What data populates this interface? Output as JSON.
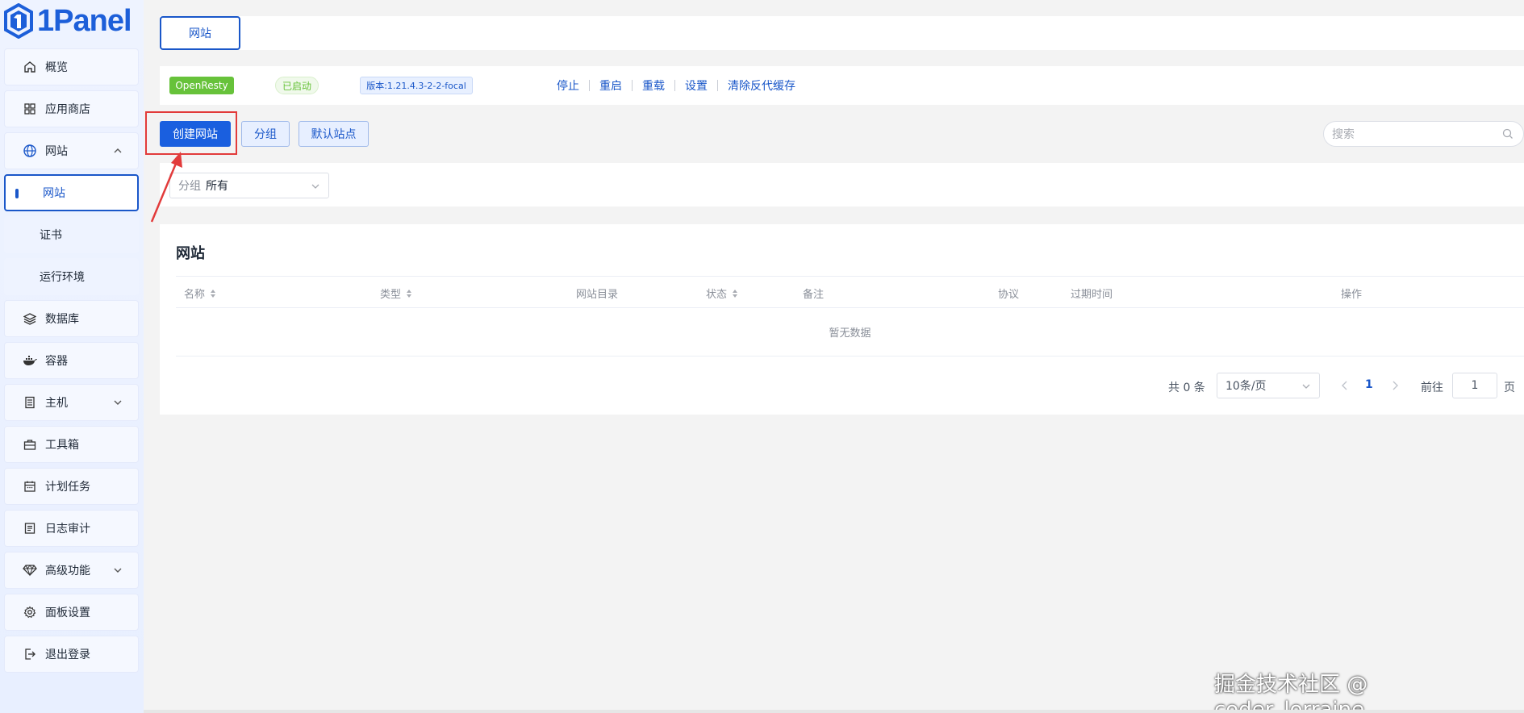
{
  "brand": {
    "logo_text": "1Panel",
    "accent": "#1a57c9"
  },
  "sidebar": {
    "items": [
      {
        "label": "概览",
        "icon": "home-icon"
      },
      {
        "label": "应用商店",
        "icon": "grid-icon"
      },
      {
        "label": "网站",
        "icon": "globe-icon",
        "expanded": true
      },
      {
        "label": "网站",
        "sub": true,
        "active": true
      },
      {
        "label": "证书",
        "sub": true
      },
      {
        "label": "运行环境",
        "sub": true
      },
      {
        "label": "数据库",
        "icon": "layers-icon"
      },
      {
        "label": "容器",
        "icon": "docker-icon"
      },
      {
        "label": "主机",
        "icon": "server-icon",
        "collapsible": true
      },
      {
        "label": "工具箱",
        "icon": "toolbox-icon"
      },
      {
        "label": "计划任务",
        "icon": "calendar-icon"
      },
      {
        "label": "日志审计",
        "icon": "log-icon"
      },
      {
        "label": "高级功能",
        "icon": "diamond-icon",
        "collapsible": true
      },
      {
        "label": "面板设置",
        "icon": "gear-icon"
      },
      {
        "label": "退出登录",
        "icon": "logout-icon"
      }
    ]
  },
  "tabs": {
    "active": "网站"
  },
  "status": {
    "app": "OpenResty",
    "state": "已启动",
    "version": "版本:1.21.4.3-2-2-focal",
    "actions": [
      "停止",
      "重启",
      "重载",
      "设置",
      "清除反代缓存"
    ]
  },
  "toolbar": {
    "create": "创建网站",
    "group": "分组",
    "default_site": "默认站点",
    "search_placeholder": "搜索"
  },
  "filter": {
    "label": "分组",
    "value": "所有"
  },
  "table": {
    "title": "网站",
    "columns": [
      "名称",
      "类型",
      "网站目录",
      "状态",
      "备注",
      "协议",
      "过期时间",
      "操作"
    ],
    "empty_text": "暂无数据"
  },
  "pagination": {
    "total": "共 0 条",
    "page_size": "10条/页",
    "current": "1",
    "goto_label": "前往",
    "goto_value": "1",
    "page_suffix": "页"
  },
  "watermark": "掘金技术社区 @ coder_lorraine"
}
